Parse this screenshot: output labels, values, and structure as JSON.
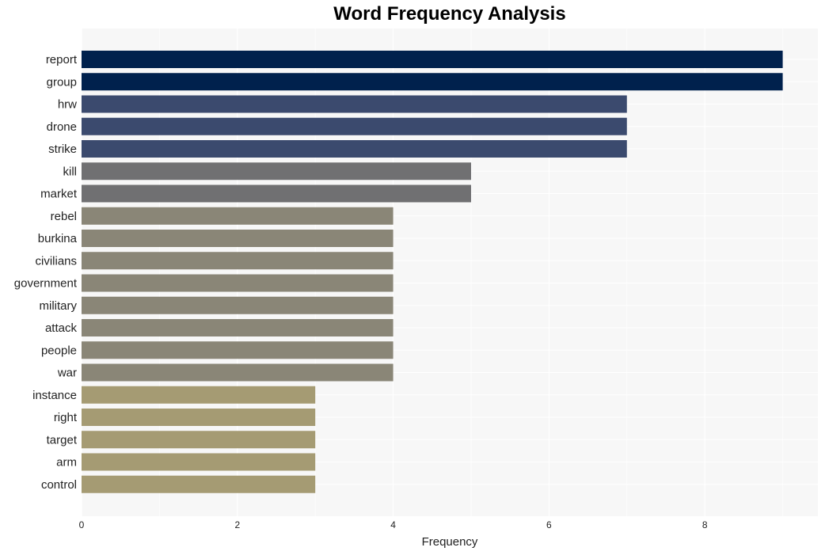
{
  "chart_data": {
    "type": "bar",
    "orientation": "horizontal",
    "title": "Word Frequency Analysis",
    "xlabel": "Frequency",
    "ylabel": "",
    "xlim": [
      0,
      9.45
    ],
    "xticks": [
      0,
      2,
      4,
      6,
      8
    ],
    "grid": true,
    "categories": [
      "report",
      "group",
      "hrw",
      "drone",
      "strike",
      "kill",
      "market",
      "rebel",
      "burkina",
      "civilians",
      "government",
      "military",
      "attack",
      "people",
      "war",
      "instance",
      "right",
      "target",
      "arm",
      "control"
    ],
    "values": [
      9,
      9,
      7,
      7,
      7,
      5,
      5,
      4,
      4,
      4,
      4,
      4,
      4,
      4,
      4,
      3,
      3,
      3,
      3,
      3
    ],
    "colors": [
      "#00214d",
      "#00214d",
      "#3b4a6e",
      "#3b4a6e",
      "#3b4a6e",
      "#707072",
      "#707072",
      "#8a8677",
      "#8a8677",
      "#8a8677",
      "#8a8677",
      "#8a8677",
      "#8a8677",
      "#8a8677",
      "#8a8677",
      "#a59b73",
      "#a59b73",
      "#a59b73",
      "#a59b73",
      "#a59b73"
    ]
  },
  "colors": {
    "plot_background": "#f7f7f7",
    "gridline": "#ffffff"
  }
}
